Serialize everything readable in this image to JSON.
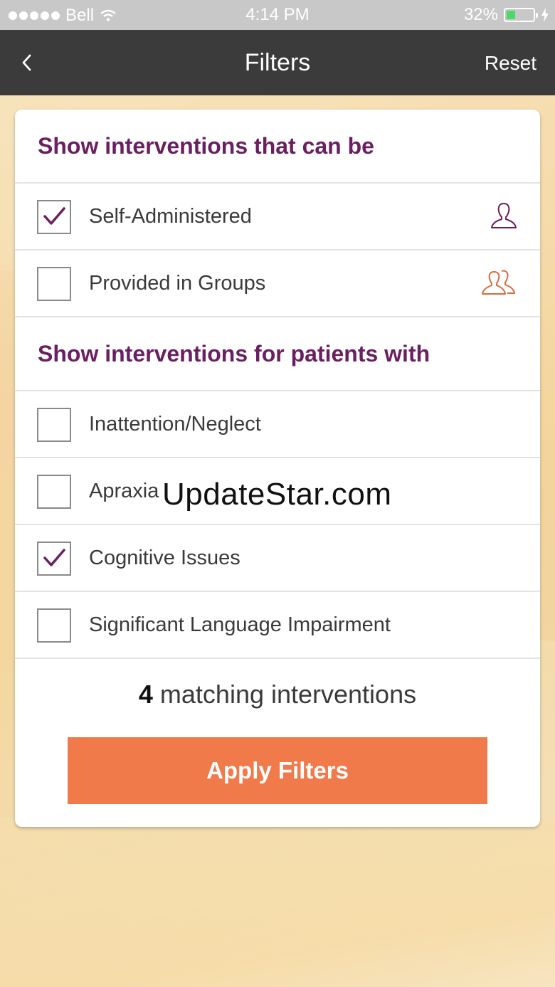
{
  "status_bar": {
    "carrier": "Bell",
    "time": "4:14 PM",
    "battery_percent": "32%",
    "battery_level": 0.32,
    "icons": [
      "signal-dots-icon",
      "wifi-icon",
      "battery-icon",
      "charging-bolt-icon"
    ]
  },
  "nav": {
    "back_icon": "chevron-left-icon",
    "title": "Filters",
    "reset_label": "Reset"
  },
  "section_can_be": {
    "heading": "Show interventions that can be",
    "items": [
      {
        "label": "Self-Administered",
        "checked": true,
        "icon": "person-icon",
        "icon_color": "#6a1f61"
      },
      {
        "label": "Provided in Groups",
        "checked": false,
        "icon": "group-icon",
        "icon_color": "#d96a3d"
      }
    ]
  },
  "section_patients": {
    "heading": "Show interventions for patients with",
    "items": [
      {
        "label": "Inattention/Neglect",
        "checked": false
      },
      {
        "label": "Apraxia",
        "checked": false
      },
      {
        "label": "Cognitive Issues",
        "checked": true
      },
      {
        "label": "Significant Language Impairment",
        "checked": false
      }
    ]
  },
  "results": {
    "count": "4",
    "suffix": "matching interventions"
  },
  "apply_label": "Apply Filters",
  "watermark": "UpdateStar.com",
  "colors": {
    "accent_purple": "#6a1f61",
    "button_orange": "#f07a4a",
    "navbar": "#3b3b3b"
  }
}
